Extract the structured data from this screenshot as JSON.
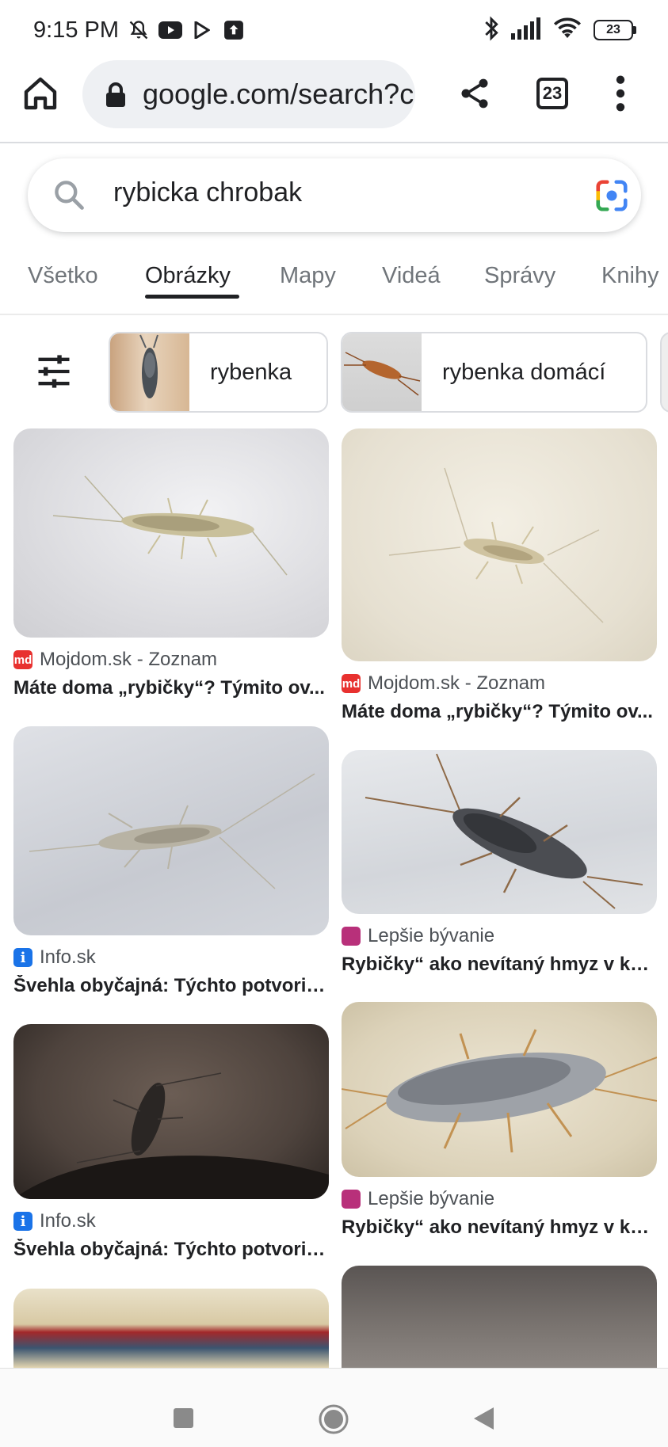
{
  "status_bar": {
    "time": "9:15 PM",
    "battery": "23",
    "icons": [
      "mute-bell-icon",
      "youtube-icon",
      "play-store-icon",
      "upload-icon",
      "bluetooth-icon",
      "signal-icon",
      "wifi-icon",
      "battery-icon"
    ]
  },
  "browser": {
    "url": "google.com/search?c",
    "tab_count": "23",
    "icons": [
      "home-icon",
      "lock-icon",
      "share-icon",
      "menu-icon"
    ]
  },
  "search": {
    "query": "rybicka chrobak",
    "icons": [
      "search-icon",
      "google-lens-icon"
    ]
  },
  "tabs": [
    {
      "label": "Všetko",
      "active": false
    },
    {
      "label": "Obrázky",
      "active": true
    },
    {
      "label": "Mapy",
      "active": false
    },
    {
      "label": "Videá",
      "active": false
    },
    {
      "label": "Správy",
      "active": false
    },
    {
      "label": "Knihy",
      "active": false
    }
  ],
  "chips": [
    {
      "label": "rybenka"
    },
    {
      "label": "rybenka domácí"
    }
  ],
  "results": [
    {
      "source": "Mojdom.sk - Zoznam",
      "favicon": "md",
      "title": "Máte doma „rybičky“? Týmito ov..."
    },
    {
      "source": "Mojdom.sk - Zoznam",
      "favicon": "md",
      "title": "Máte doma „rybičky“? Týmito ov..."
    },
    {
      "source": "Info.sk",
      "favicon": "i",
      "title": "Švehla obyčajná: Týchto potvorie..."
    },
    {
      "source": "Lepšie bývanie",
      "favicon": "",
      "title": "Rybičky“ ako nevítaný hmyz v kú..."
    },
    {
      "source": "Info.sk",
      "favicon": "i",
      "title": "Švehla obyčajná: Týchto potvorie..."
    },
    {
      "source": "Lepšie bývanie",
      "favicon": "",
      "title": "Rybičky“ ako nevítaný hmyz v kú..."
    }
  ],
  "nav": {
    "icons": [
      "recent-apps-icon",
      "home-circle-icon",
      "back-icon"
    ]
  },
  "colors": {
    "accent": "#1a73e8",
    "text": "#202124",
    "muted": "#70757a",
    "url_bg": "#eef0f3"
  }
}
